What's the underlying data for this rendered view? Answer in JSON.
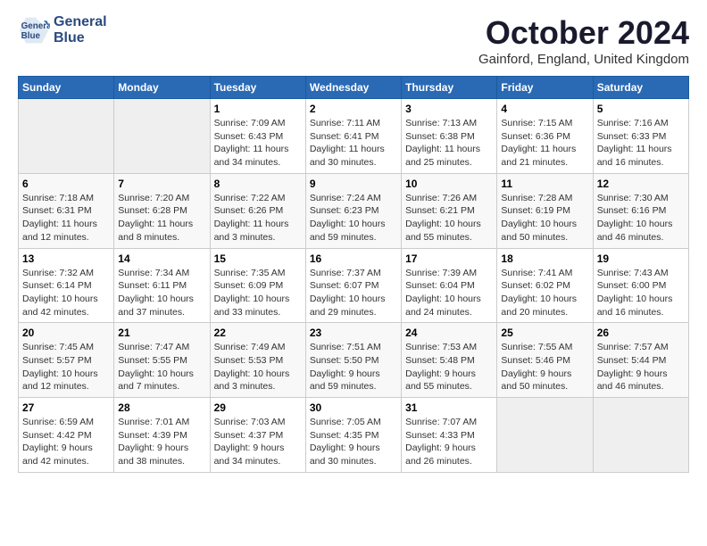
{
  "header": {
    "logo_line1": "General",
    "logo_line2": "Blue",
    "month": "October 2024",
    "location": "Gainford, England, United Kingdom"
  },
  "weekdays": [
    "Sunday",
    "Monday",
    "Tuesday",
    "Wednesday",
    "Thursday",
    "Friday",
    "Saturday"
  ],
  "weeks": [
    [
      {
        "day": "",
        "empty": true
      },
      {
        "day": "",
        "empty": true
      },
      {
        "day": "1",
        "sunrise": "Sunrise: 7:09 AM",
        "sunset": "Sunset: 6:43 PM",
        "daylight": "Daylight: 11 hours and 34 minutes."
      },
      {
        "day": "2",
        "sunrise": "Sunrise: 7:11 AM",
        "sunset": "Sunset: 6:41 PM",
        "daylight": "Daylight: 11 hours and 30 minutes."
      },
      {
        "day": "3",
        "sunrise": "Sunrise: 7:13 AM",
        "sunset": "Sunset: 6:38 PM",
        "daylight": "Daylight: 11 hours and 25 minutes."
      },
      {
        "day": "4",
        "sunrise": "Sunrise: 7:15 AM",
        "sunset": "Sunset: 6:36 PM",
        "daylight": "Daylight: 11 hours and 21 minutes."
      },
      {
        "day": "5",
        "sunrise": "Sunrise: 7:16 AM",
        "sunset": "Sunset: 6:33 PM",
        "daylight": "Daylight: 11 hours and 16 minutes."
      }
    ],
    [
      {
        "day": "6",
        "sunrise": "Sunrise: 7:18 AM",
        "sunset": "Sunset: 6:31 PM",
        "daylight": "Daylight: 11 hours and 12 minutes."
      },
      {
        "day": "7",
        "sunrise": "Sunrise: 7:20 AM",
        "sunset": "Sunset: 6:28 PM",
        "daylight": "Daylight: 11 hours and 8 minutes."
      },
      {
        "day": "8",
        "sunrise": "Sunrise: 7:22 AM",
        "sunset": "Sunset: 6:26 PM",
        "daylight": "Daylight: 11 hours and 3 minutes."
      },
      {
        "day": "9",
        "sunrise": "Sunrise: 7:24 AM",
        "sunset": "Sunset: 6:23 PM",
        "daylight": "Daylight: 10 hours and 59 minutes."
      },
      {
        "day": "10",
        "sunrise": "Sunrise: 7:26 AM",
        "sunset": "Sunset: 6:21 PM",
        "daylight": "Daylight: 10 hours and 55 minutes."
      },
      {
        "day": "11",
        "sunrise": "Sunrise: 7:28 AM",
        "sunset": "Sunset: 6:19 PM",
        "daylight": "Daylight: 10 hours and 50 minutes."
      },
      {
        "day": "12",
        "sunrise": "Sunrise: 7:30 AM",
        "sunset": "Sunset: 6:16 PM",
        "daylight": "Daylight: 10 hours and 46 minutes."
      }
    ],
    [
      {
        "day": "13",
        "sunrise": "Sunrise: 7:32 AM",
        "sunset": "Sunset: 6:14 PM",
        "daylight": "Daylight: 10 hours and 42 minutes."
      },
      {
        "day": "14",
        "sunrise": "Sunrise: 7:34 AM",
        "sunset": "Sunset: 6:11 PM",
        "daylight": "Daylight: 10 hours and 37 minutes."
      },
      {
        "day": "15",
        "sunrise": "Sunrise: 7:35 AM",
        "sunset": "Sunset: 6:09 PM",
        "daylight": "Daylight: 10 hours and 33 minutes."
      },
      {
        "day": "16",
        "sunrise": "Sunrise: 7:37 AM",
        "sunset": "Sunset: 6:07 PM",
        "daylight": "Daylight: 10 hours and 29 minutes."
      },
      {
        "day": "17",
        "sunrise": "Sunrise: 7:39 AM",
        "sunset": "Sunset: 6:04 PM",
        "daylight": "Daylight: 10 hours and 24 minutes."
      },
      {
        "day": "18",
        "sunrise": "Sunrise: 7:41 AM",
        "sunset": "Sunset: 6:02 PM",
        "daylight": "Daylight: 10 hours and 20 minutes."
      },
      {
        "day": "19",
        "sunrise": "Sunrise: 7:43 AM",
        "sunset": "Sunset: 6:00 PM",
        "daylight": "Daylight: 10 hours and 16 minutes."
      }
    ],
    [
      {
        "day": "20",
        "sunrise": "Sunrise: 7:45 AM",
        "sunset": "Sunset: 5:57 PM",
        "daylight": "Daylight: 10 hours and 12 minutes."
      },
      {
        "day": "21",
        "sunrise": "Sunrise: 7:47 AM",
        "sunset": "Sunset: 5:55 PM",
        "daylight": "Daylight: 10 hours and 7 minutes."
      },
      {
        "day": "22",
        "sunrise": "Sunrise: 7:49 AM",
        "sunset": "Sunset: 5:53 PM",
        "daylight": "Daylight: 10 hours and 3 minutes."
      },
      {
        "day": "23",
        "sunrise": "Sunrise: 7:51 AM",
        "sunset": "Sunset: 5:50 PM",
        "daylight": "Daylight: 9 hours and 59 minutes."
      },
      {
        "day": "24",
        "sunrise": "Sunrise: 7:53 AM",
        "sunset": "Sunset: 5:48 PM",
        "daylight": "Daylight: 9 hours and 55 minutes."
      },
      {
        "day": "25",
        "sunrise": "Sunrise: 7:55 AM",
        "sunset": "Sunset: 5:46 PM",
        "daylight": "Daylight: 9 hours and 50 minutes."
      },
      {
        "day": "26",
        "sunrise": "Sunrise: 7:57 AM",
        "sunset": "Sunset: 5:44 PM",
        "daylight": "Daylight: 9 hours and 46 minutes."
      }
    ],
    [
      {
        "day": "27",
        "sunrise": "Sunrise: 6:59 AM",
        "sunset": "Sunset: 4:42 PM",
        "daylight": "Daylight: 9 hours and 42 minutes."
      },
      {
        "day": "28",
        "sunrise": "Sunrise: 7:01 AM",
        "sunset": "Sunset: 4:39 PM",
        "daylight": "Daylight: 9 hours and 38 minutes."
      },
      {
        "day": "29",
        "sunrise": "Sunrise: 7:03 AM",
        "sunset": "Sunset: 4:37 PM",
        "daylight": "Daylight: 9 hours and 34 minutes."
      },
      {
        "day": "30",
        "sunrise": "Sunrise: 7:05 AM",
        "sunset": "Sunset: 4:35 PM",
        "daylight": "Daylight: 9 hours and 30 minutes."
      },
      {
        "day": "31",
        "sunrise": "Sunrise: 7:07 AM",
        "sunset": "Sunset: 4:33 PM",
        "daylight": "Daylight: 9 hours and 26 minutes."
      },
      {
        "day": "",
        "empty": true
      },
      {
        "day": "",
        "empty": true
      }
    ]
  ]
}
